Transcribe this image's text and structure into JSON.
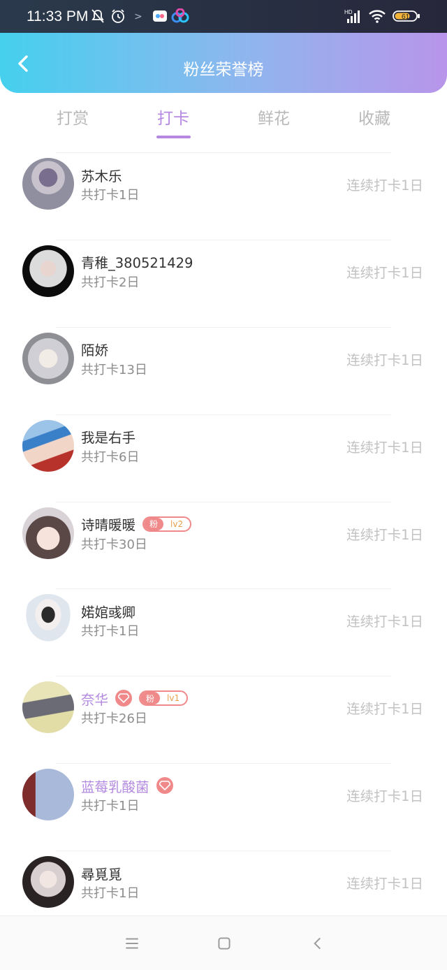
{
  "status_bar": {
    "time": "11:33 PM",
    "battery": "61",
    "network": "HD"
  },
  "header": {
    "title": "粉丝荣誉榜"
  },
  "tabs": [
    {
      "label": "打赏",
      "active": false
    },
    {
      "label": "打卡",
      "active": true
    },
    {
      "label": "鲜花",
      "active": false
    },
    {
      "label": "收藏",
      "active": false
    }
  ],
  "colors": {
    "accent": "#b589e2",
    "header_start": "#45d0ee",
    "header_end": "#b895ea",
    "badge": "#f08a8a"
  },
  "fans": [
    {
      "name": "苏木乐",
      "total": "共打卡1日",
      "streak": "连续打卡1日",
      "highlight": false
    },
    {
      "name": "青稚_380521429",
      "total": "共打卡2日",
      "streak": "连续打卡1日",
      "highlight": false
    },
    {
      "name": "陌娇",
      "total": "共打卡13日",
      "streak": "连续打卡1日",
      "highlight": false
    },
    {
      "name": "我是右手",
      "total": "共打卡6日",
      "streak": "连续打卡1日",
      "highlight": false
    },
    {
      "name": "诗晴暖暖",
      "total": "共打卡30日",
      "streak": "连续打卡1日",
      "highlight": false,
      "badge_prefix": "粉",
      "badge_level": "lv2"
    },
    {
      "name": "婼婠彧卿",
      "total": "共打卡1日",
      "streak": "连续打卡1日",
      "highlight": false
    },
    {
      "name": "奈华",
      "total": "共打卡26日",
      "streak": "连续打卡1日",
      "highlight": true,
      "gem": true,
      "badge_prefix": "粉",
      "badge_level": "lv1"
    },
    {
      "name": "蓝莓乳酸菌",
      "total": "共打卡1日",
      "streak": "连续打卡1日",
      "highlight": true,
      "gem": true
    },
    {
      "name": "尋覓覓",
      "total": "共打卡1日",
      "streak": "连续打卡1日",
      "highlight": false
    }
  ],
  "nav": {
    "icons": [
      "menu-icon",
      "home-icon",
      "back-icon"
    ]
  }
}
